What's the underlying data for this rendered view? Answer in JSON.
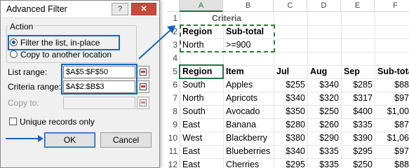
{
  "dialog": {
    "title": "Advanced Filter",
    "help_glyph": "?",
    "close_glyph": "✕",
    "action_label": "Action",
    "radio_filter_in_place": "Filter the list, in-place",
    "radio_copy": "Copy to another location",
    "list_range_label": "List range:",
    "list_range_value": "$A$5:$F$50",
    "criteria_range_label": "Criteria range:",
    "criteria_range_value": "$A$2:$B$3",
    "copy_to_label": "Copy to:",
    "copy_to_value": "",
    "unique_label": "Unique records only",
    "ok_label": "OK",
    "cancel_label": "Cancel"
  },
  "sheet": {
    "columns": [
      "A",
      "B",
      "C",
      "D",
      "E",
      "F"
    ],
    "rows": [
      "1",
      "2",
      "3",
      "4",
      "5",
      "6",
      "7",
      "8",
      "9",
      "10",
      "11",
      "12"
    ],
    "criteria_title": "Criteria",
    "criteria_headers": [
      "Region",
      "Sub-total"
    ],
    "criteria_values": [
      "North",
      ">=900"
    ],
    "headers": [
      "Region",
      "Item",
      "Jul",
      "Aug",
      "Sep",
      "Sub-tota"
    ],
    "data": [
      [
        "South",
        "Apples",
        "$255",
        "$340",
        "$285",
        "$88"
      ],
      [
        "North",
        "Apricots",
        "$340",
        "$320",
        "$317",
        "$97"
      ],
      [
        "South",
        "Avocado",
        "$350",
        "$250",
        "$400",
        "$1,00"
      ],
      [
        "East",
        "Banana",
        "$280",
        "$260",
        "$335",
        "$87"
      ],
      [
        "West",
        "Blackberry",
        "$380",
        "$290",
        "$390",
        "$1,06"
      ],
      [
        "East",
        "Blueberries",
        "$340",
        "$335",
        "$295",
        "$97"
      ],
      [
        "East",
        "Cherries",
        "$295",
        "$335",
        "$250",
        "$88"
      ]
    ]
  },
  "colors": {
    "dashed_border": "#2e7d32",
    "highlight_blue": "#1565c0",
    "active_cell": "#217346"
  }
}
